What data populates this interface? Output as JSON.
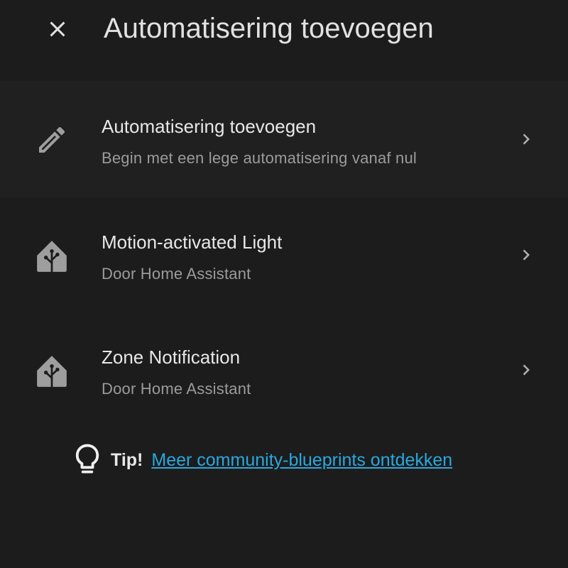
{
  "header": {
    "title": "Automatisering toevoegen",
    "close_icon": "close-icon"
  },
  "items": [
    {
      "title": "Automatisering toevoegen",
      "subtitle": "Begin met een lege automatisering vanaf nul",
      "icon": "pencil-icon"
    },
    {
      "title": "Motion-activated Light",
      "subtitle": "Door Home Assistant",
      "icon": "home-assistant-icon"
    },
    {
      "title": "Zone Notification",
      "subtitle": "Door Home Assistant",
      "icon": "home-assistant-icon"
    }
  ],
  "tip": {
    "label": "Tip!",
    "link_text": "Meer community-blueprints ontdekken",
    "icon": "lightbulb-icon"
  },
  "colors": {
    "background": "#1c1c1c",
    "highlight_row": "#202020",
    "primary_text": "#e1e1e1",
    "secondary_text": "#9b9b9b",
    "icon": "#9e9e9e",
    "link": "#2aa7de"
  }
}
